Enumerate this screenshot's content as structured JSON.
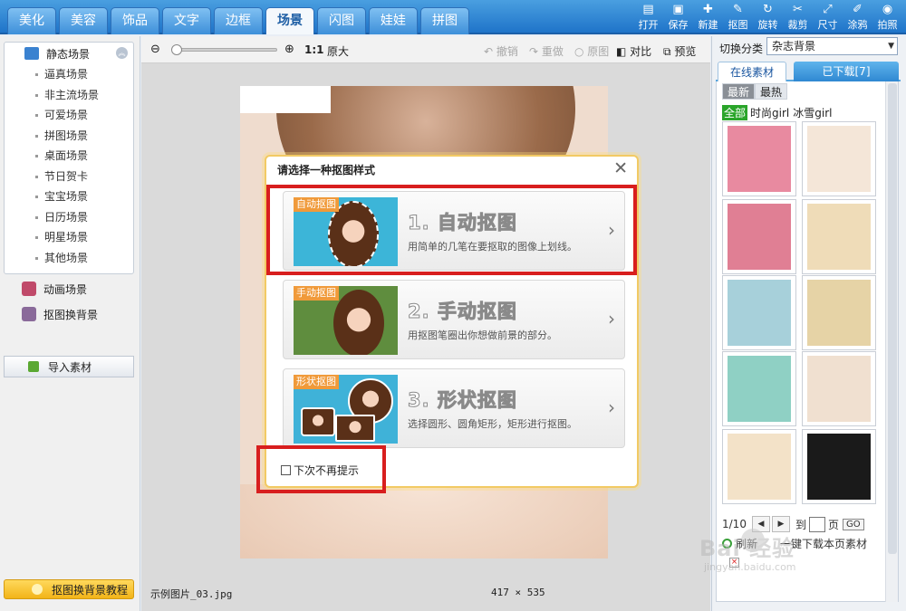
{
  "colors": {
    "accent": "#2a7fd4",
    "highlight": "#d81e1e",
    "tutorial": "#f5c23a"
  },
  "top_tabs": [
    {
      "label": "美化",
      "active": false
    },
    {
      "label": "美容",
      "active": false
    },
    {
      "label": "饰品",
      "active": false
    },
    {
      "label": "文字",
      "active": false
    },
    {
      "label": "边框",
      "active": false
    },
    {
      "label": "场景",
      "active": true
    },
    {
      "label": "闪图",
      "active": false
    },
    {
      "label": "娃娃",
      "active": false
    },
    {
      "label": "拼图",
      "active": false
    }
  ],
  "tools": [
    {
      "label": "打开",
      "icon": "folder-icon"
    },
    {
      "label": "保存",
      "icon": "save-icon"
    },
    {
      "label": "新建",
      "icon": "plus-icon"
    },
    {
      "label": "抠图",
      "icon": "cutout-icon"
    },
    {
      "label": "旋转",
      "icon": "rotate-icon"
    },
    {
      "label": "裁剪",
      "icon": "crop-icon"
    },
    {
      "label": "尺寸",
      "icon": "resize-icon"
    },
    {
      "label": "涂鸦",
      "icon": "brush-icon"
    },
    {
      "label": "拍照",
      "icon": "camera-icon"
    }
  ],
  "sidebar": {
    "static_scene": "静态场景",
    "sub_items": [
      "逼真场景",
      "非主流场景",
      "可爱场景",
      "拼图场景",
      "桌面场景",
      "节日贺卡",
      "宝宝场景",
      "日历场景",
      "明星场景",
      "其他场景"
    ],
    "anim_scene": "动画场景",
    "cutout_bg": "抠图换背景",
    "import": "导入素材",
    "tutorial": "抠图换背景教程"
  },
  "view_toolbar": {
    "ratio": "1:1",
    "original_size": "原大",
    "undo": "撤销",
    "redo": "重做",
    "original": "原图",
    "compare": "对比",
    "preview": "预览"
  },
  "status": {
    "filename": "示例图片_03.jpg",
    "dims": "417 × 535"
  },
  "dialog": {
    "title": "请选择一种抠图样式",
    "close": "✕",
    "options": [
      {
        "tag": "自动抠图",
        "title": "1. 自动抠图",
        "desc": "用简单的几笔在要抠取的图像上划线。"
      },
      {
        "tag": "手动抠图",
        "title": "2. 手动抠图",
        "desc": "用抠图笔圈出你想做前景的部分。"
      },
      {
        "tag": "形状抠图",
        "title": "3. 形状抠图",
        "desc": "选择圆形、圆角矩形，矩形进行抠图。"
      }
    ],
    "dont_show": "下次不再提示"
  },
  "right": {
    "switch_label": "切换分类",
    "category": "杂志背景",
    "tab_online": "在线素材",
    "tab_downloaded": "已下载[7]",
    "sort_new": "最新",
    "sort_hot": "最热",
    "tag_all": "全部",
    "tags": [
      "时尚girl",
      "冰雪girl"
    ],
    "page": "1/10",
    "to_label": "到",
    "page_label": "页",
    "go": "GO",
    "refresh": "刷新",
    "download_all": "一键下载本页素材",
    "thumb_colors": [
      "#e88aa0",
      "#f4e6d8",
      "#e07f94",
      "#efdcb8",
      "#a7d0da",
      "#e6d3a6",
      "#8fd0c4",
      "#f0e0d0",
      "#f3e2c8",
      "#1a1a1a"
    ]
  },
  "watermark": {
    "main": "Bai  经验",
    "sub": "jingyan.baidu.com"
  }
}
